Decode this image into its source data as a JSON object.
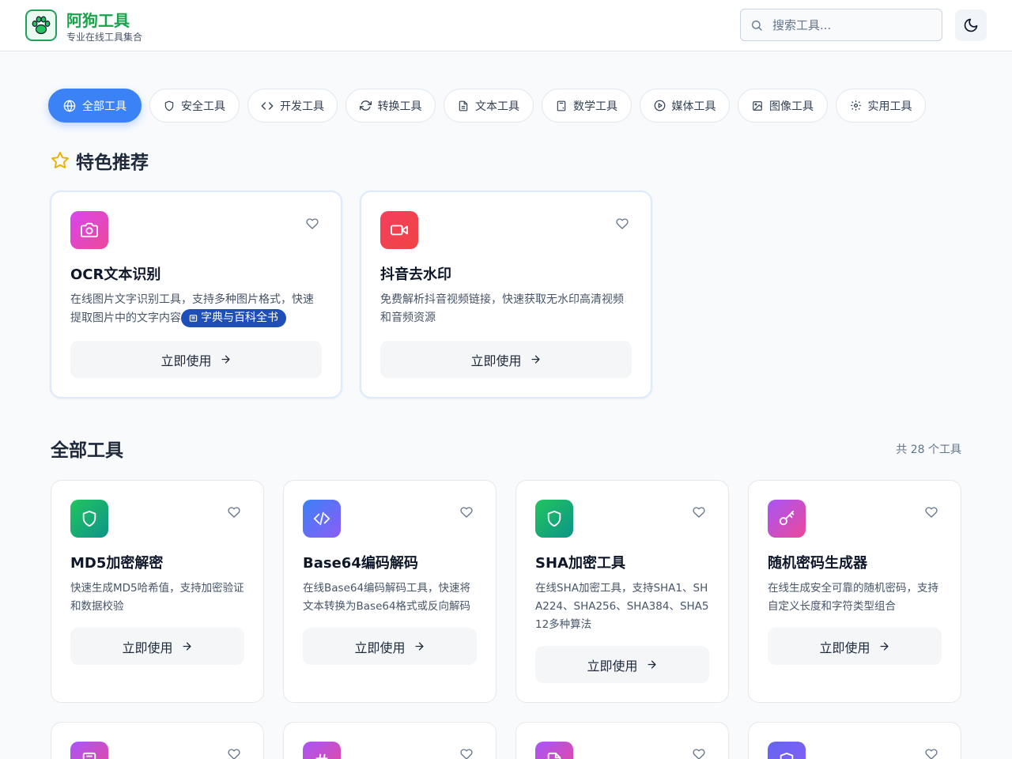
{
  "header": {
    "brand_title": "阿狗工具",
    "brand_subtitle": "专业在线工具集合",
    "search_placeholder": "搜索工具..."
  },
  "categories": [
    {
      "label": "全部工具",
      "icon": "globe-icon",
      "active": true
    },
    {
      "label": "安全工具",
      "icon": "shield-icon"
    },
    {
      "label": "开发工具",
      "icon": "code-icon"
    },
    {
      "label": "转换工具",
      "icon": "refresh-icon"
    },
    {
      "label": "文本工具",
      "icon": "file-text-icon"
    },
    {
      "label": "数学工具",
      "icon": "calculator-icon"
    },
    {
      "label": "媒体工具",
      "icon": "play-circle-icon"
    },
    {
      "label": "图像工具",
      "icon": "image-icon"
    },
    {
      "label": "实用工具",
      "icon": "gear-icon"
    }
  ],
  "featured": {
    "heading": "特色推荐",
    "cards": [
      {
        "title": "OCR文本识别",
        "desc": "在线图片文字识别工具，支持多种图片格式，快速提取图片中的文字内容",
        "badge": "字典与百科全书",
        "button": "立即使用",
        "icon": "camera-icon"
      },
      {
        "title": "抖音去水印",
        "desc": "免费解析抖音视频链接，快速获取无水印高清视频和音频资源",
        "button": "立即使用",
        "icon": "video-icon"
      }
    ]
  },
  "all_tools": {
    "heading": "全部工具",
    "count_text": "共 28 个工具",
    "cards": [
      {
        "title": "MD5加密解密",
        "desc": "快速生成MD5哈希值，支持加密验证和数据校验",
        "button": "立即使用",
        "icon": "shield-icon"
      },
      {
        "title": "Base64编码解码",
        "desc": "在线Base64编码解码工具，快速将文本转换为Base64格式或反向解码",
        "button": "立即使用",
        "icon": "code-icon"
      },
      {
        "title": "SHA加密工具",
        "desc": "在线SHA加密工具，支持SHA1、SHA224、SHA256、SHA384、SHA512多种算法",
        "button": "立即使用",
        "icon": "shield-icon"
      },
      {
        "title": "随机密码生成器",
        "desc": "在线生成安全可靠的随机密码，支持自定义长度和字符类型组合",
        "button": "立即使用",
        "icon": "key-icon"
      }
    ]
  },
  "colors": {
    "accent": "#3b82f6",
    "brand": "#16a34a",
    "badge": "#1e4fb8"
  }
}
